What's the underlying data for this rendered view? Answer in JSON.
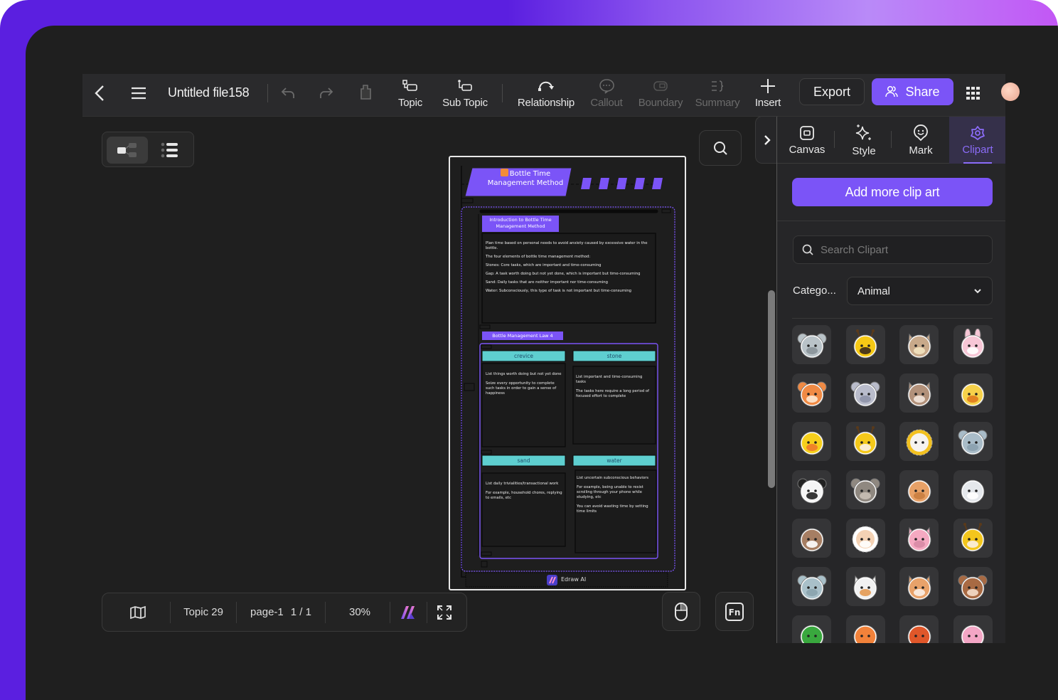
{
  "toolbar": {
    "back_icon": "chevron-left-icon",
    "menu_icon": "hamburger-menu-icon",
    "file_title": "Untitled file158",
    "undo_icon": "undo-icon",
    "redo_icon": "redo-icon",
    "format_painter_icon": "format-painter-icon",
    "tools": [
      {
        "label": "Topic",
        "icon": "topic-icon",
        "enabled": true
      },
      {
        "label": "Sub Topic",
        "icon": "subtopic-icon",
        "enabled": true
      },
      {
        "label": "Relationship",
        "icon": "relationship-icon",
        "enabled": true
      },
      {
        "label": "Callout",
        "icon": "callout-icon",
        "enabled": false
      },
      {
        "label": "Boundary",
        "icon": "boundary-icon",
        "enabled": false
      },
      {
        "label": "Summary",
        "icon": "summary-icon",
        "enabled": false
      },
      {
        "label": "Insert",
        "icon": "plus-icon",
        "enabled": true
      }
    ],
    "export_label": "Export",
    "share_label": "Share",
    "apps_icon": "apps-grid-icon"
  },
  "view_toggle": {
    "options": [
      "mind-map-view",
      "outline-view"
    ],
    "active": "mind-map-view"
  },
  "diagram": {
    "title": "Bottle Time Management Method",
    "intro_heading": "Introduction to Bottle Time Management Method",
    "intro_lines": [
      "Plan time based on personal needs to avoid anxiety caused by excessive water in the bottle.",
      "The four elements of bottle time management method:",
      "Stones: Core tasks, which are important and time-consuming",
      "Gap: A task worth doing but not yet done, which is important but time-consuming",
      "Sand: Daily tasks that are neither important nor time-consuming",
      "Water: Subconsciously, this type of task is not important but time-consuming"
    ],
    "law_heading": "Bottle Management Law 4",
    "quadrants": [
      {
        "label": "crevice",
        "lines": [
          "List things worth doing but not yet done",
          "Seize every opportunity to complete such tasks in order to gain a sense of happiness"
        ]
      },
      {
        "label": "stone",
        "lines": [
          "List important and time-consuming tasks",
          "The tasks here require a long period of focused effort to complete"
        ]
      },
      {
        "label": "sand",
        "lines": [
          "List daily trivialities/transactional work",
          "For example, household chores, replying to emails, etc"
        ]
      },
      {
        "label": "water",
        "lines": [
          "List uncertain subconscious behaviors",
          "For example, being unable to resist scrolling through your phone while studying, etc",
          "You can avoid wasting time by setting time limits"
        ]
      }
    ],
    "watermark": "Edraw AI"
  },
  "statusbar": {
    "map_icon": "map-icon",
    "topic_count": "Topic 29",
    "page_name": "page-1",
    "page_index": "1 / 1",
    "zoom": "30%",
    "ai_icon": "edraw-ai-icon",
    "fullscreen_icon": "fullscreen-icon"
  },
  "floating": {
    "search_icon": "search-icon",
    "mouse_icon": "mouse-icon",
    "fn_icon": "fn-key-icon"
  },
  "panel": {
    "tabs": [
      {
        "label": "Canvas",
        "icon": "canvas-icon"
      },
      {
        "label": "Style",
        "icon": "sparkle-icon"
      },
      {
        "label": "Mark",
        "icon": "smiley-pin-icon"
      },
      {
        "label": "Clipart",
        "icon": "flower-icon"
      }
    ],
    "active_tab": "Clipart",
    "add_button": "Add more clip art",
    "search_placeholder": "Search Clipart",
    "category_label": "Catego...",
    "category_value": "Animal",
    "cliparts": [
      "hippo",
      "bee",
      "cow",
      "rabbit",
      "tiger",
      "mouse",
      "donkey",
      "chick",
      "duck",
      "deer",
      "lion",
      "elephant",
      "panda",
      "bear",
      "dog",
      "sheep",
      "owl",
      "hedgehog",
      "pig",
      "giraffe",
      "koala",
      "cat",
      "fox",
      "monkey",
      "frog",
      "crab",
      "shrimp",
      "octopus"
    ]
  },
  "colors": {
    "accent": "#7b54f7",
    "accent_text": "#8b6cf8",
    "teal": "#5ecfd0",
    "background": "#1f1f1f"
  }
}
